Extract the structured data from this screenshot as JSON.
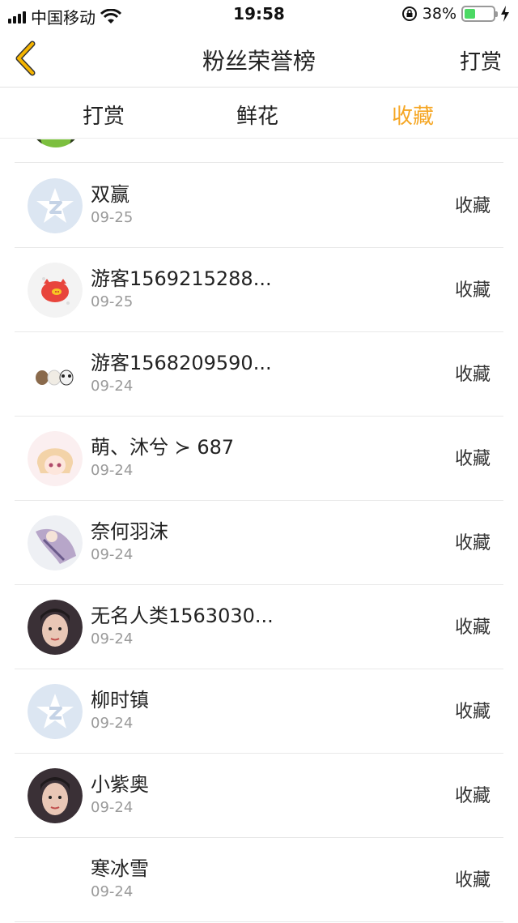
{
  "status_bar": {
    "carrier": "中国移动",
    "time": "19:58",
    "battery": "38%",
    "battery_level": 0.38
  },
  "nav": {
    "title": "粉丝荣誉榜",
    "right_label": "打赏"
  },
  "tabs": [
    {
      "label": "打赏",
      "active": false
    },
    {
      "label": "鲜花",
      "active": false
    },
    {
      "label": "收藏",
      "active": true
    }
  ],
  "colors": {
    "accent": "#f5a623",
    "back_icon": "#f5b400"
  },
  "list": [
    {
      "name": "双赢",
      "date": "09-25",
      "action": "收藏",
      "avatar": "qq-star-default-avatar"
    },
    {
      "name": "游客1569215288...",
      "date": "09-25",
      "action": "收藏",
      "avatar": "red-pig-avatar"
    },
    {
      "name": "游客1568209590...",
      "date": "09-24",
      "action": "收藏",
      "avatar": "three-bears-avatar"
    },
    {
      "name": "萌、沐兮 ≻ 687",
      "date": "09-24",
      "action": "收藏",
      "avatar": "anime-girl-avatar"
    },
    {
      "name": "奈何羽沫",
      "date": "09-24",
      "action": "收藏",
      "avatar": "anime-illustration-avatar"
    },
    {
      "name": "无名人类1563030...",
      "date": "09-24",
      "action": "收藏",
      "avatar": "photo-woman-avatar"
    },
    {
      "name": "柳时镇",
      "date": "09-24",
      "action": "收藏",
      "avatar": "qq-star-default-avatar"
    },
    {
      "name": "小紫奥",
      "date": "09-24",
      "action": "收藏",
      "avatar": "photo-woman-avatar"
    },
    {
      "name": "寒冰雪",
      "date": "09-24",
      "action": "收藏",
      "avatar": "blank-avatar"
    }
  ]
}
